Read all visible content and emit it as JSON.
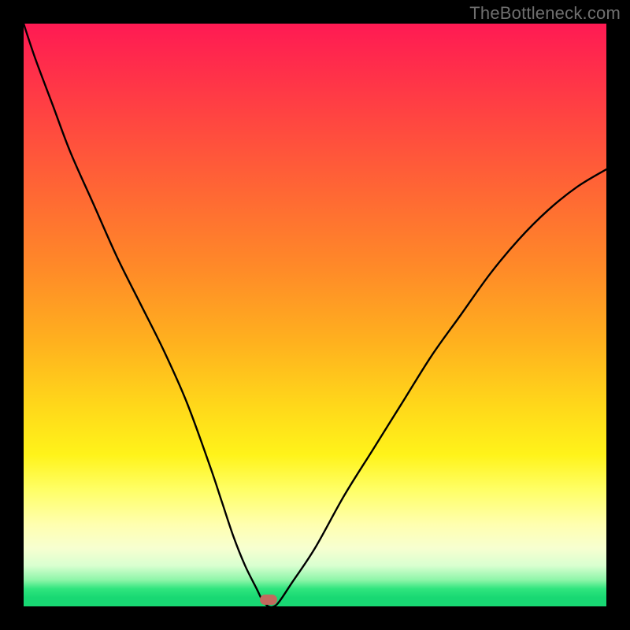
{
  "watermark": "TheBottleneck.com",
  "colors": {
    "frame": "#000000",
    "curve_stroke": "#000000",
    "marker_fill": "#c26a5e"
  },
  "chart_data": {
    "type": "line",
    "title": "",
    "xlabel": "",
    "ylabel": "",
    "xlim": [
      0,
      100
    ],
    "ylim": [
      0,
      100
    ],
    "grid": false,
    "legend": false,
    "note": "Axes are unlabeled in the source image; x/y are normalized 0–100. Curve shows a single deep notch (global minimum) with steep approach from the left and shallower rise to the right.",
    "series": [
      {
        "name": "bottleneck-curve",
        "x": [
          0,
          2,
          5,
          8,
          12,
          16,
          20,
          24,
          28,
          32,
          34,
          36,
          38,
          40,
          41,
          42,
          43,
          44,
          46,
          50,
          55,
          60,
          65,
          70,
          75,
          80,
          85,
          90,
          95,
          100
        ],
        "y": [
          100,
          94,
          86,
          78,
          69,
          60,
          52,
          44,
          35,
          24,
          18,
          12,
          7,
          3,
          1,
          0,
          0,
          1,
          4,
          10,
          19,
          27,
          35,
          43,
          50,
          57,
          63,
          68,
          72,
          75
        ]
      }
    ],
    "marker": {
      "x": 42,
      "y": 0,
      "shape": "pill"
    }
  }
}
